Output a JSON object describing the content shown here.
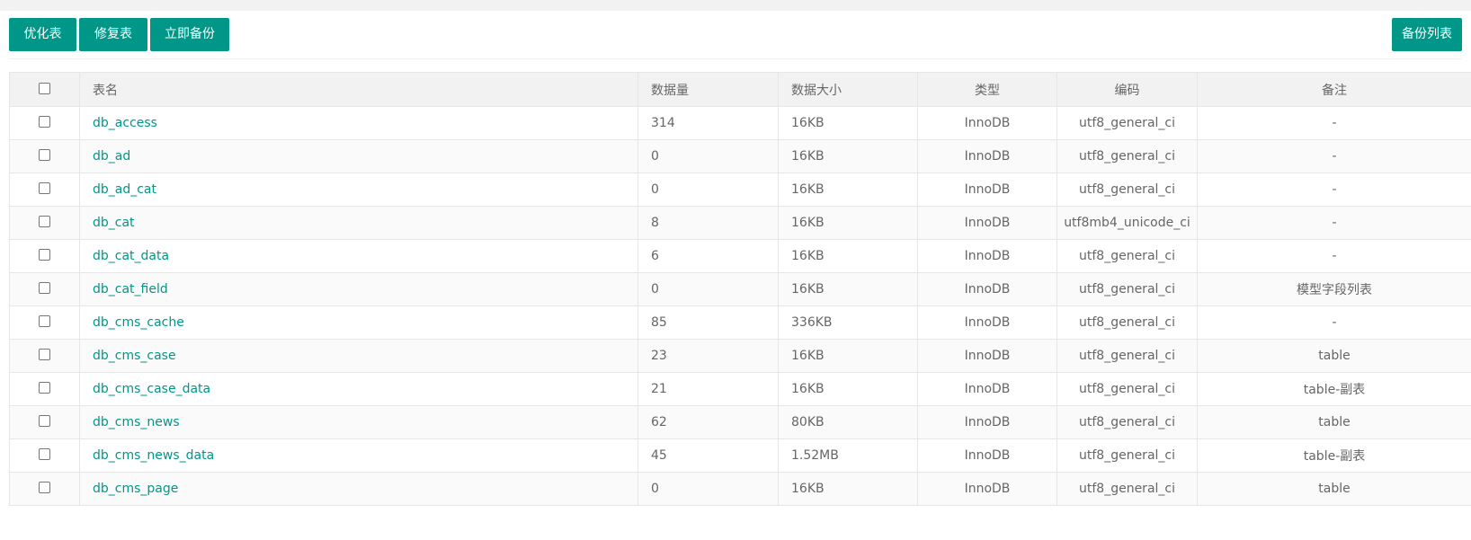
{
  "toolbar": {
    "optimize_label": "优化表",
    "repair_label": "修复表",
    "backup_now_label": "立即备份",
    "backup_list_label": "备份列表"
  },
  "colors": {
    "accent": "#009688",
    "header_bg": "#f2f2f2",
    "border": "#e6e6e6"
  },
  "table": {
    "headers": {
      "name": "表名",
      "rows": "数据量",
      "size": "数据大小",
      "type": "类型",
      "collation": "编码",
      "note": "备注"
    },
    "rows": [
      {
        "name": "db_access",
        "rows": "314",
        "size": "16KB",
        "type": "InnoDB",
        "collation": "utf8_general_ci",
        "note": "-"
      },
      {
        "name": "db_ad",
        "rows": "0",
        "size": "16KB",
        "type": "InnoDB",
        "collation": "utf8_general_ci",
        "note": "-"
      },
      {
        "name": "db_ad_cat",
        "rows": "0",
        "size": "16KB",
        "type": "InnoDB",
        "collation": "utf8_general_ci",
        "note": "-"
      },
      {
        "name": "db_cat",
        "rows": "8",
        "size": "16KB",
        "type": "InnoDB",
        "collation": "utf8mb4_unicode_ci",
        "note": "-"
      },
      {
        "name": "db_cat_data",
        "rows": "6",
        "size": "16KB",
        "type": "InnoDB",
        "collation": "utf8_general_ci",
        "note": "-"
      },
      {
        "name": "db_cat_field",
        "rows": "0",
        "size": "16KB",
        "type": "InnoDB",
        "collation": "utf8_general_ci",
        "note": "模型字段列表"
      },
      {
        "name": "db_cms_cache",
        "rows": "85",
        "size": "336KB",
        "type": "InnoDB",
        "collation": "utf8_general_ci",
        "note": "-"
      },
      {
        "name": "db_cms_case",
        "rows": "23",
        "size": "16KB",
        "type": "InnoDB",
        "collation": "utf8_general_ci",
        "note": "table"
      },
      {
        "name": "db_cms_case_data",
        "rows": "21",
        "size": "16KB",
        "type": "InnoDB",
        "collation": "utf8_general_ci",
        "note": "table-副表"
      },
      {
        "name": "db_cms_news",
        "rows": "62",
        "size": "80KB",
        "type": "InnoDB",
        "collation": "utf8_general_ci",
        "note": "table"
      },
      {
        "name": "db_cms_news_data",
        "rows": "45",
        "size": "1.52MB",
        "type": "InnoDB",
        "collation": "utf8_general_ci",
        "note": "table-副表"
      },
      {
        "name": "db_cms_page",
        "rows": "0",
        "size": "16KB",
        "type": "InnoDB",
        "collation": "utf8_general_ci",
        "note": "table"
      }
    ]
  }
}
